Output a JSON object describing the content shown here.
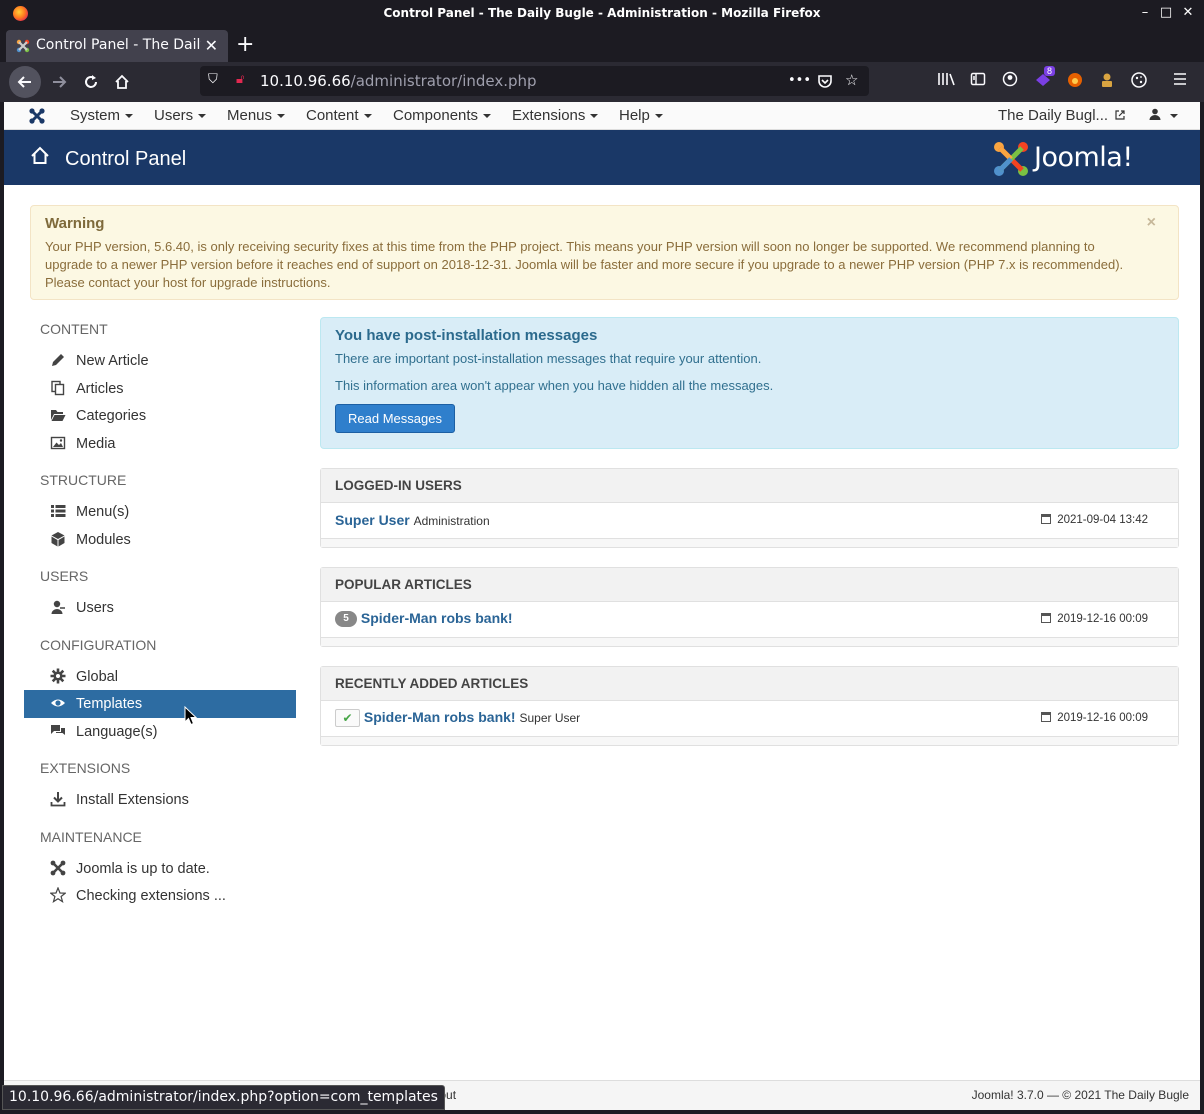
{
  "window": {
    "title": "Control Panel - The Daily Bugle - Administration - Mozilla Firefox",
    "minimize": "–",
    "maximize": "□",
    "close": "✕"
  },
  "tab": {
    "title": "Control Panel - The Daily Bugle",
    "close": "✕",
    "new_tab": "+"
  },
  "urlbar": {
    "host": "10.10.96.66",
    "path": "/administrator/index.php",
    "more": "•••"
  },
  "extensions": {
    "badge_count": "8"
  },
  "joomla_nav": {
    "menus": [
      "System",
      "Users",
      "Menus",
      "Content",
      "Components",
      "Extensions",
      "Help"
    ],
    "site_link": "The Daily Bugl..."
  },
  "header": {
    "title": "Control Panel",
    "brand": "Joomla!"
  },
  "warning": {
    "title": "Warning",
    "text": "Your PHP version, 5.6.40, is only receiving security fixes at this time from the PHP project. This means your PHP version will soon no longer be supported. We recommend planning to upgrade to a newer PHP version before it reaches end of support on 2018-12-31. Joomla will be faster and more secure if you upgrade to a newer PHP version (PHP 7.x is recommended). Please contact your host for upgrade instructions.",
    "close": "×"
  },
  "sidebar": {
    "content": {
      "heading": "CONTENT",
      "items": [
        "New Article",
        "Articles",
        "Categories",
        "Media"
      ]
    },
    "structure": {
      "heading": "STRUCTURE",
      "items": [
        "Menu(s)",
        "Modules"
      ]
    },
    "users": {
      "heading": "USERS",
      "items": [
        "Users"
      ]
    },
    "configuration": {
      "heading": "CONFIGURATION",
      "items": [
        "Global",
        "Templates",
        "Language(s)"
      ]
    },
    "extensions": {
      "heading": "EXTENSIONS",
      "items": [
        "Install Extensions"
      ]
    },
    "maintenance": {
      "heading": "MAINTENANCE",
      "items": [
        "Joomla is up to date.",
        "Checking extensions ..."
      ]
    }
  },
  "postinstall": {
    "title": "You have post-installation messages",
    "text1": "There are important post-installation messages that require your attention.",
    "text2": "This information area won't appear when you have hidden all the messages.",
    "button": "Read Messages"
  },
  "logged_in": {
    "title": "LOGGED-IN USERS",
    "user": "Super User",
    "context": "Administration",
    "date": "2021-09-04 13:42"
  },
  "popular": {
    "title": "POPULAR ARTICLES",
    "hits": "5",
    "article": "Spider-Man robs bank!",
    "date": "2019-12-16 00:09"
  },
  "recent": {
    "title": "RECENTLY ADDED ARTICLES",
    "check": "✔",
    "article": "Spider-Man robs bank!",
    "author": "Super User",
    "date": "2019-12-16 00:09"
  },
  "footer": {
    "logout": "Log out",
    "copyright": "Joomla! 3.7.0  —  © 2021 The Daily Bugle"
  },
  "statusbar": {
    "url": "10.10.96.66/administrator/index.php?option=com_templates"
  },
  "colors": {
    "header_bg": "#1a3867",
    "active_item": "#2d6ca2",
    "link": "#2a6496",
    "warning_bg": "#fcf8e3",
    "info_bg": "#d9edf7"
  }
}
